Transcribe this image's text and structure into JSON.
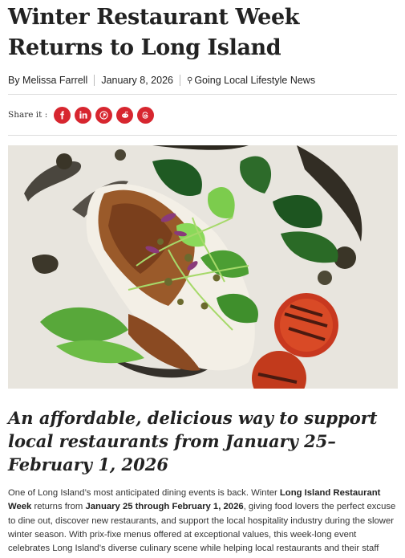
{
  "article": {
    "title": "Winter Restaurant Week Returns to Long Island",
    "author": "By Melissa Farrell",
    "date": "January 8, 2026",
    "source": "Going Local Lifestyle News",
    "share_label": "Share it :",
    "share_buttons": [
      {
        "icon": "facebook-icon"
      },
      {
        "icon": "linkedin-icon"
      },
      {
        "icon": "pinterest-icon"
      },
      {
        "icon": "reddit-icon"
      },
      {
        "icon": "threads-icon"
      }
    ],
    "subheading": "An affordable, delicious way to support local restaurants from January 25–February 1, 2026",
    "body": {
      "p1": "One of Long Island’s most anticipated dining events is back. Winter ",
      "b1": "Long Island Restaurant Week",
      "p2": " returns from ",
      "b2": "January 25 through February 1, 2026",
      "p3": ", giving food lovers the perfect excuse to dine out, discover new restaurants, and support the local hospitality industry during the slower winter season. With prix-fixe menus offered at exceptional values, this week-long event celebrates Long Island’s diverse culinary scene while helping local restaurants and their staff thrive."
    }
  },
  "colors": {
    "accent": "#d7262f",
    "text": "#222222"
  }
}
